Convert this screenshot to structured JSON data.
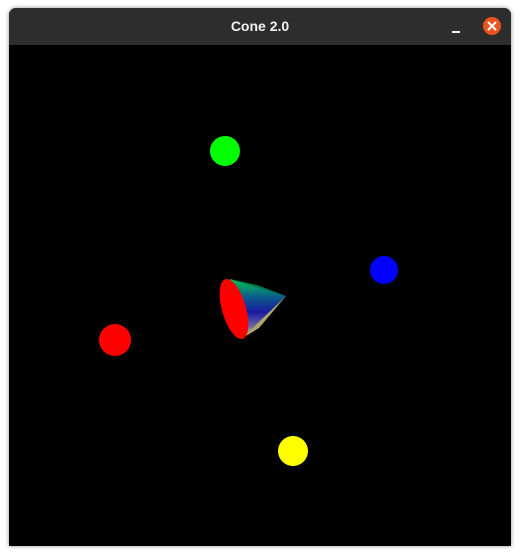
{
  "window": {
    "title": "Cone 2.0",
    "minimize_icon": "minimize-icon",
    "close_icon": "close-icon",
    "close_button_color": "#e95420"
  },
  "scene": {
    "background_color": "#000000",
    "spheres": [
      {
        "name": "green-sphere",
        "color": "#00ff00"
      },
      {
        "name": "blue-sphere",
        "color": "#0000ff"
      },
      {
        "name": "red-sphere",
        "color": "#ff0000"
      },
      {
        "name": "yellow-sphere",
        "color": "#ffff00"
      }
    ],
    "cone": {
      "base_color": "#ff0000",
      "surface_colors": [
        "#00c853",
        "#0b3d91",
        "#1a1aa0",
        "#fff6a0"
      ]
    }
  }
}
